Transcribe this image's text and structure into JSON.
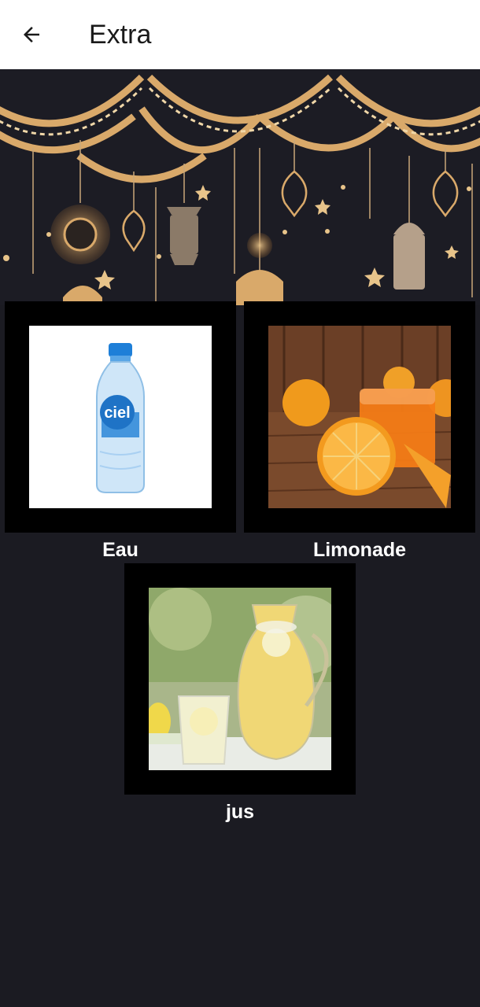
{
  "appbar": {
    "title": "Extra",
    "back_icon": "arrow-left-icon"
  },
  "colors": {
    "background": "#1b1b22",
    "appbar": "#ffffff",
    "card_frame": "#000000",
    "banner_gold": "#d9a96a"
  },
  "items": [
    {
      "label": "Eau",
      "image": "water-bottle-photo"
    },
    {
      "label": "Limonade",
      "image": "orange-juice-photo"
    },
    {
      "label": "jus",
      "image": "lemonade-pitcher-photo"
    }
  ]
}
